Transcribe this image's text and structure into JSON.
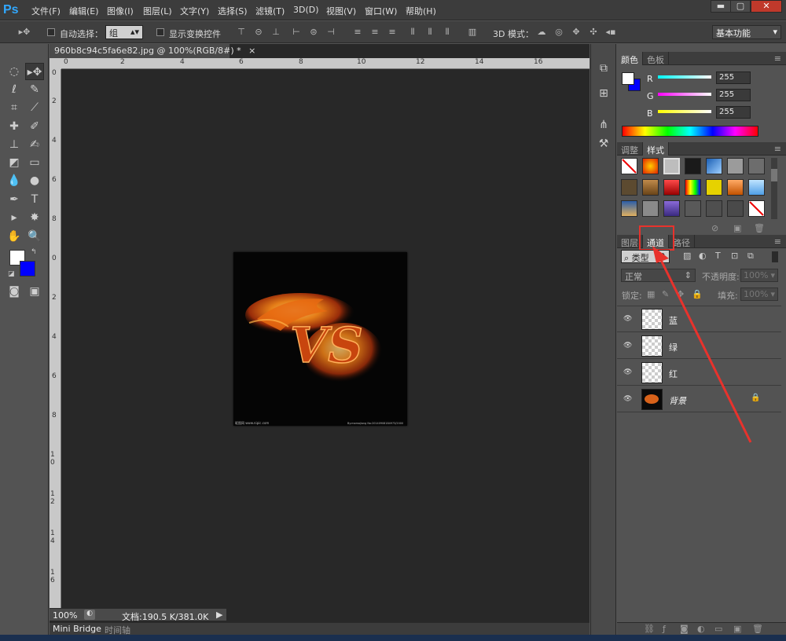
{
  "app": {
    "logo": "Ps"
  },
  "menu": [
    "文件(F)",
    "编辑(E)",
    "图像(I)",
    "图层(L)",
    "文字(Y)",
    "选择(S)",
    "滤镜(T)",
    "3D(D)",
    "视图(V)",
    "窗口(W)",
    "帮助(H)"
  ],
  "window_controls": {
    "minimize": "▬",
    "maximize": "▢",
    "close": "✕"
  },
  "options": {
    "auto_select_label": "自动选择：",
    "auto_select_value": "组",
    "show_transform_label": "显示变换控件",
    "mode_3d_label": "3D 模式：",
    "workspace": "基本功能"
  },
  "document": {
    "tab_title": "960b8c94c5fa6e82.jpg @ 100%(RGB/8#) *",
    "close": "×",
    "zoom": "100%",
    "doc_info": "文档:190.5 K/381.0K",
    "canvas_text": "VS",
    "watermark_left": "昵图网 www.nipic.com",
    "watermark_right": "By:mamajiang No:20140908184973/2000"
  },
  "ruler_h": [
    "0",
    "2",
    "4",
    "6",
    "8",
    "10",
    "12",
    "14",
    "16"
  ],
  "ruler_v": [
    "0",
    "2",
    "4",
    "6",
    "8",
    "0",
    "2",
    "4",
    "6",
    "8",
    "1 0",
    "1 2",
    "1 4",
    "1 6"
  ],
  "bottom_tabs": [
    "Mini Bridge",
    "时间轴"
  ],
  "color_panel": {
    "tabs": [
      "颜色",
      "色板"
    ],
    "channels": [
      {
        "label": "R",
        "value": "255"
      },
      {
        "label": "G",
        "value": "255"
      },
      {
        "label": "B",
        "value": "255"
      }
    ],
    "foreground": "#ffffff",
    "background": "#0000ff"
  },
  "styles_panel": {
    "tabs": [
      "调整",
      "样式"
    ]
  },
  "layers_panel": {
    "tabs": [
      "图层",
      "通道",
      "路径"
    ],
    "filter_label": "类型",
    "blend_mode": "正常",
    "opacity_label": "不透明度:",
    "opacity_value": "100%",
    "lock_label": "锁定:",
    "fill_label": "填充:",
    "fill_value": "100%",
    "layers": [
      "蓝",
      "绿",
      "红",
      "背景"
    ]
  },
  "colors": {
    "accent_red": "#e8322c",
    "ps_blue": "#31a8ff"
  }
}
